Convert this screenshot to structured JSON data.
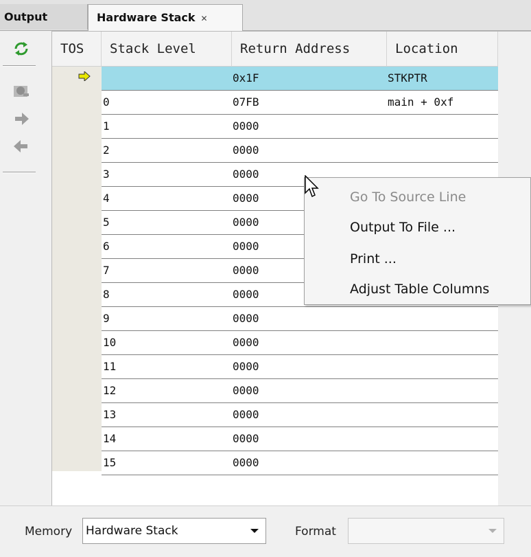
{
  "tabs": [
    {
      "label": "Output"
    },
    {
      "label": "Hardware Stack",
      "close_icon": "✕"
    }
  ],
  "toolbar": {
    "icons": [
      "refresh-icon",
      "zoom-icon",
      "push-icon",
      "pop-icon"
    ]
  },
  "table": {
    "columns": [
      "TOS",
      "Stack Level",
      "Return Address",
      "Location"
    ],
    "rows": [
      {
        "level": "",
        "address": "0x1F",
        "location": "STKPTR",
        "selected": true
      },
      {
        "level": "0",
        "address": "07FB",
        "location": "main + 0xf"
      },
      {
        "level": "1",
        "address": "0000",
        "location": ""
      },
      {
        "level": "2",
        "address": "0000",
        "location": ""
      },
      {
        "level": "3",
        "address": "0000",
        "location": ""
      },
      {
        "level": "4",
        "address": "0000",
        "location": ""
      },
      {
        "level": "5",
        "address": "0000",
        "location": ""
      },
      {
        "level": "6",
        "address": "0000",
        "location": ""
      },
      {
        "level": "7",
        "address": "0000",
        "location": ""
      },
      {
        "level": "8",
        "address": "0000",
        "location": ""
      },
      {
        "level": "9",
        "address": "0000",
        "location": ""
      },
      {
        "level": "10",
        "address": "0000",
        "location": ""
      },
      {
        "level": "11",
        "address": "0000",
        "location": ""
      },
      {
        "level": "12",
        "address": "0000",
        "location": ""
      },
      {
        "level": "13",
        "address": "0000",
        "location": ""
      },
      {
        "level": "14",
        "address": "0000",
        "location": ""
      },
      {
        "level": "15",
        "address": "0000",
        "location": ""
      }
    ]
  },
  "context_menu": {
    "items": [
      {
        "label": "Go To Source Line",
        "enabled": false
      },
      {
        "label": "Output To File ...",
        "enabled": true
      },
      {
        "label": "Print ...",
        "enabled": true
      },
      {
        "label": "Adjust Table Columns",
        "enabled": true
      }
    ]
  },
  "bottom": {
    "memory_label": "Memory",
    "memory_value": "Hardware Stack",
    "format_label": "Format",
    "format_value": ""
  },
  "colors": {
    "selected_row": "#9ddbe9",
    "tos_strip": "#ebe9e1",
    "arrow": "#e8e800"
  }
}
